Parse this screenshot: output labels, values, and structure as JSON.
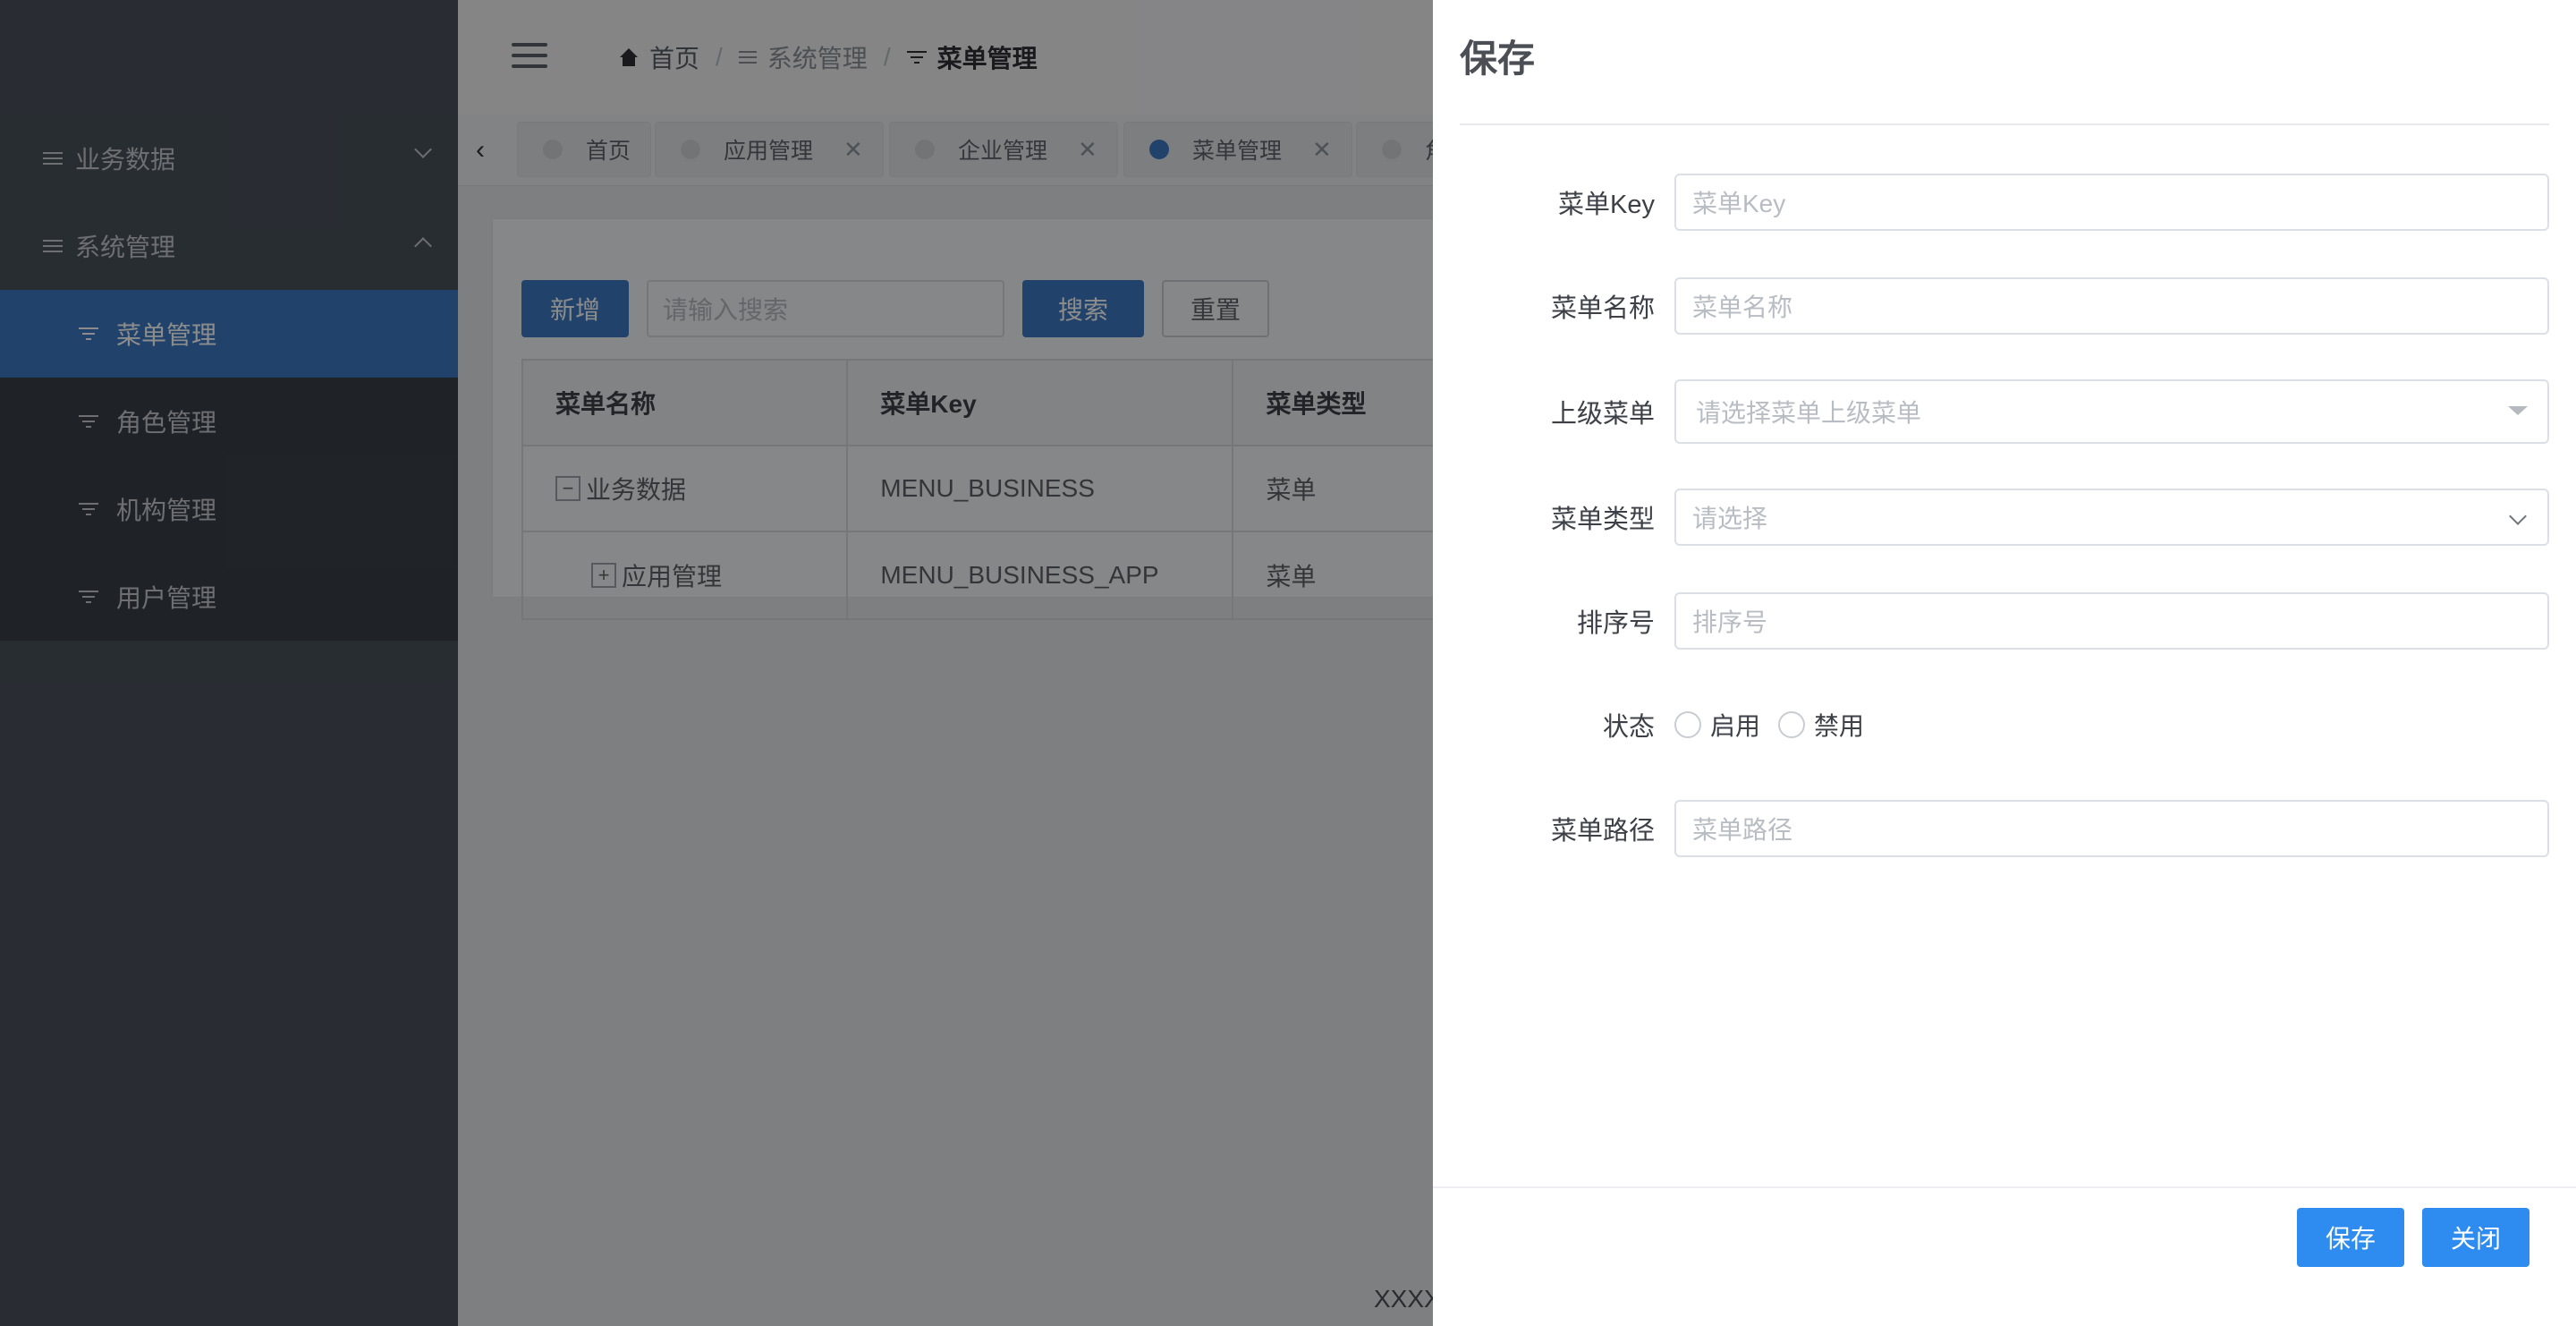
{
  "sidebar": {
    "groups": [
      {
        "label": "业务数据",
        "icon": "menu-lines-icon",
        "expanded": false
      },
      {
        "label": "系统管理",
        "icon": "menu-lines-icon",
        "expanded": true
      }
    ],
    "items": [
      {
        "label": "菜单管理",
        "icon": "filter-icon",
        "active": true
      },
      {
        "label": "角色管理",
        "icon": "filter-icon",
        "active": false
      },
      {
        "label": "机构管理",
        "icon": "filter-icon",
        "active": false
      },
      {
        "label": "用户管理",
        "icon": "filter-icon",
        "active": false
      }
    ]
  },
  "breadcrumb": [
    {
      "label": "首页",
      "icon": "home-icon"
    },
    {
      "label": "系统管理",
      "icon": "menu-lines-icon"
    },
    {
      "label": "菜单管理",
      "icon": "filter-icon"
    }
  ],
  "tabs": [
    {
      "label": "首页",
      "closable": false,
      "active": false
    },
    {
      "label": "应用管理",
      "closable": true,
      "active": false
    },
    {
      "label": "企业管理",
      "closable": true,
      "active": false
    },
    {
      "label": "菜单管理",
      "closable": true,
      "active": true
    },
    {
      "label": "角",
      "closable": false,
      "active": false
    }
  ],
  "toolbar": {
    "add_label": "新增",
    "search_placeholder": "请输入搜索",
    "search_label": "搜索",
    "reset_label": "重置"
  },
  "table": {
    "columns": [
      "菜单名称",
      "菜单Key",
      "菜单类型"
    ],
    "rows": [
      {
        "expander": "−",
        "name": "业务数据",
        "key": "MENU_BUSINESS",
        "type": "菜单"
      },
      {
        "expander": "+",
        "name": "应用管理",
        "key": "MENU_BUSINESS_APP",
        "type": "菜单"
      }
    ]
  },
  "footer_text": "XXXX",
  "drawer": {
    "title": "保存",
    "fields": {
      "menu_key": {
        "label": "菜单Key",
        "placeholder": "菜单Key",
        "value": ""
      },
      "menu_name": {
        "label": "菜单名称",
        "placeholder": "菜单名称",
        "value": ""
      },
      "parent_menu": {
        "label": "上级菜单",
        "placeholder": "请选择菜单上级菜单"
      },
      "menu_type": {
        "label": "菜单类型",
        "placeholder": "请选择"
      },
      "sort_no": {
        "label": "排序号",
        "placeholder": "排序号",
        "value": ""
      },
      "status": {
        "label": "状态",
        "options": [
          "启用",
          "禁用"
        ],
        "selected": null
      },
      "menu_path": {
        "label": "菜单路径",
        "placeholder": "菜单路径",
        "value": ""
      }
    },
    "save_label": "保存",
    "close_label": "关闭"
  },
  "colors": {
    "primary": "#3c7bc4",
    "drawer_button": "#2e8cf0",
    "sidebar_bg": "#4a525c"
  }
}
